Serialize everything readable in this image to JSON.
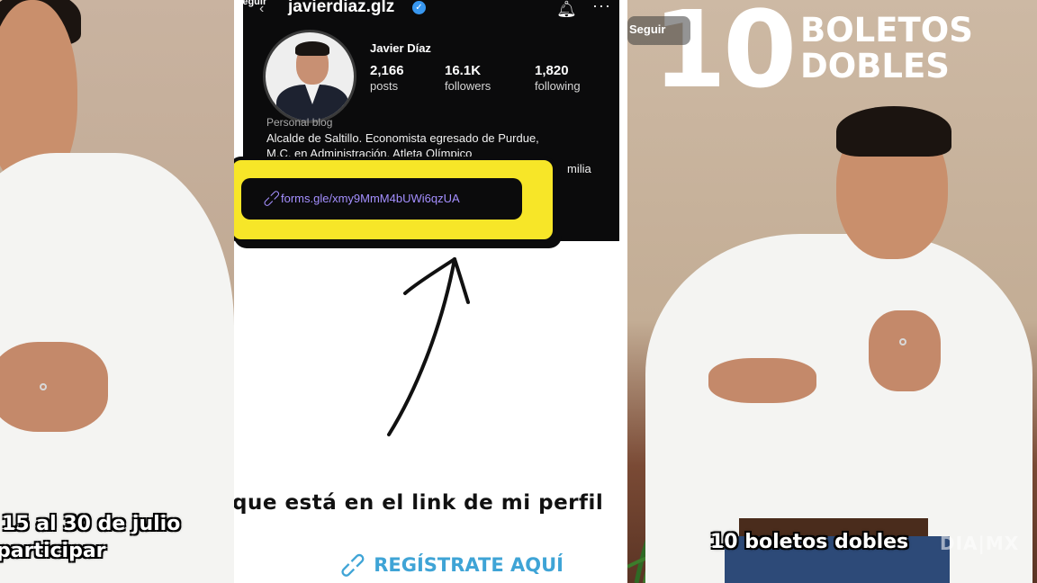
{
  "left_panel": {
    "caption_line1": "15 al 30 de julio",
    "caption_line2": "participar"
  },
  "middle_panel": {
    "seguir_label": "Seguir",
    "profile": {
      "handle": "javierdiaz.glz",
      "display_name": "Javier Díaz",
      "posts_count": "2,166",
      "posts_label": "posts",
      "followers_count": "16.1K",
      "followers_label": "followers",
      "following_count": "1,820",
      "following_label": "following",
      "category": "Personal blog",
      "bio_line1": "Alcalde de Saltillo. Economista egresado de Purdue,",
      "bio_line2": "M.C. en Administración. Atleta Olímpico",
      "bio_line3": "milia",
      "link": "forms.gle/xmy9MmM4bUWi6qzUA"
    },
    "caption": "que está en el link de mi perfil",
    "register_link": "REGÍSTRATE AQUÍ"
  },
  "right_panel": {
    "seguir_label": "Seguir",
    "headline_number": "10",
    "headline_line1": "BOLETOS",
    "headline_line2": "DOBLES",
    "caption": "10 boletos dobles",
    "watermark": "DIA|MX"
  },
  "icons": {
    "verified": "verified-badge-icon",
    "bell": "bell-icon",
    "more": "more-icon",
    "link": "link-icon",
    "back": "back-arrow-icon"
  },
  "colors": {
    "highlight": "#f7e628",
    "link": "#a48fff",
    "register": "#3fa4d6",
    "verified": "#3897f0"
  }
}
